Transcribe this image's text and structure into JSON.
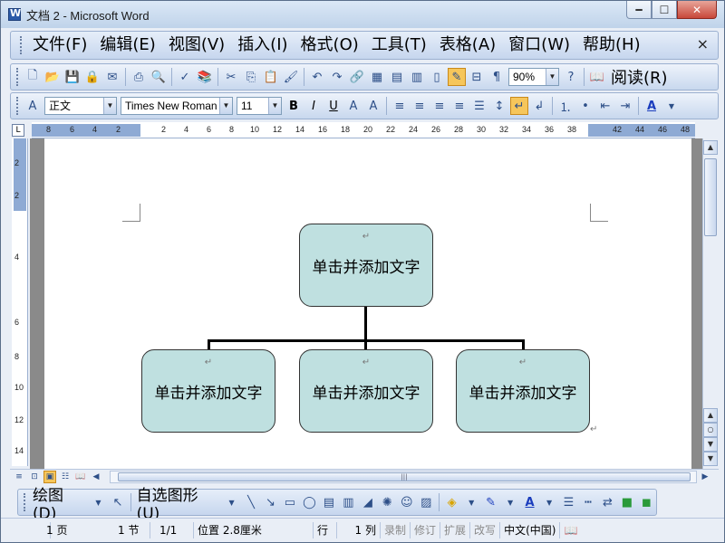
{
  "window": {
    "title": "文档 2 - Microsoft Word",
    "minimize": "━",
    "maximize": "☐",
    "close": "✕"
  },
  "menu": {
    "items": [
      "文件(F)",
      "编辑(E)",
      "视图(V)",
      "插入(I)",
      "格式(O)",
      "工具(T)",
      "表格(A)",
      "窗口(W)",
      "帮助(H)"
    ],
    "close_doc": "×"
  },
  "standard_toolbar": {
    "zoom": "90%",
    "read_label": "阅读(R)"
  },
  "format_toolbar": {
    "style": "正文",
    "font": "Times New Roman",
    "size": "11",
    "bold": "B",
    "italic": "I",
    "underline": "U",
    "font_color_label": "A"
  },
  "ruler": {
    "h_ticks": [
      "8",
      "6",
      "4",
      "2",
      "",
      "2",
      "4",
      "6",
      "8",
      "10",
      "12",
      "14",
      "16",
      "18",
      "20",
      "22",
      "24",
      "26",
      "28",
      "30",
      "32",
      "34",
      "36",
      "38",
      "",
      "42",
      "44",
      "46",
      "48"
    ],
    "v_ticks": [
      "2",
      "",
      "2",
      "",
      "4",
      "",
      "6",
      "",
      "8",
      "",
      "10",
      "12",
      "14"
    ],
    "corner": "L"
  },
  "diagram": {
    "root": "单击并添加文字",
    "children": [
      "单击并添加文字",
      "单击并添加文字",
      "单击并添加文字"
    ],
    "para_mark": "↵"
  },
  "drawing_toolbar": {
    "draw_label": "绘图(D)",
    "autoshape_label": "自选图形(U)"
  },
  "status": {
    "page": "1 页",
    "section": "1 节",
    "page_of": "1/1",
    "position": "位置 2.8厘米",
    "line": "行",
    "col": "1 列",
    "rec": "录制",
    "trk": "修订",
    "ext": "扩展",
    "ovr": "改写",
    "lang": "中文(中国)"
  }
}
